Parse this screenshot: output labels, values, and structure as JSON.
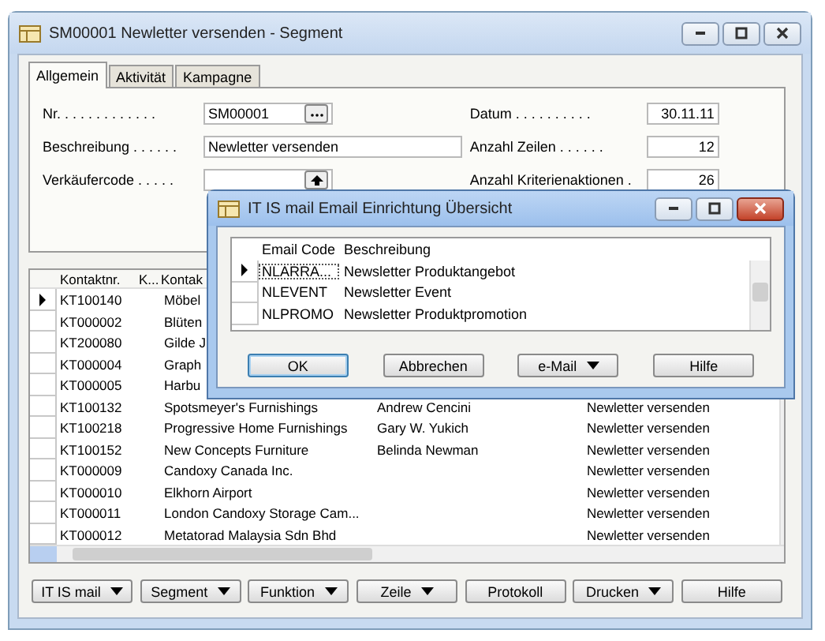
{
  "window": {
    "title": "SM00001 Newletter versenden - Segment"
  },
  "tabs": [
    {
      "label": "Allgemein",
      "selected": true
    },
    {
      "label": "Aktivität",
      "selected": false
    },
    {
      "label": "Kampagne",
      "selected": false
    }
  ],
  "fields_left": [
    {
      "label": "Nr. . . . . . . . . . . . .",
      "value": "SM00001",
      "kind": "lookup"
    },
    {
      "label": "Beschreibung . . . . . .",
      "value": "Newletter versenden",
      "kind": "text"
    },
    {
      "label": "Verkäufercode . . . . .",
      "kind": "dropdown"
    }
  ],
  "fields_right": [
    {
      "label": "Datum . . . . . . . . . .",
      "value": "30.11.11"
    },
    {
      "label": "Anzahl Zeilen . . . . . .",
      "value": "12"
    },
    {
      "label": "Anzahl Kriterienaktionen .",
      "value": "26"
    }
  ],
  "table": {
    "columns": [
      "Kontaktnr.",
      "K...",
      "Kontak"
    ],
    "rows": [
      {
        "selected": true,
        "contact_no": "KT100140",
        "name": "Möbel"
      },
      {
        "selected": false,
        "contact_no": "KT000002",
        "name": "Blüten"
      },
      {
        "selected": false,
        "contact_no": "KT200080",
        "name": "Gilde J"
      },
      {
        "selected": false,
        "contact_no": "KT000004",
        "name": "Graph"
      },
      {
        "selected": false,
        "contact_no": "KT000005",
        "name": "Harbu"
      },
      {
        "selected": false,
        "contact_no": "KT100132",
        "name": "Spotsmeyer's Furnishings",
        "column_4": "Andrew Cencini",
        "column_5": "Newletter versenden"
      },
      {
        "selected": false,
        "contact_no": "KT100218",
        "name": "Progressive Home Furnishings",
        "column_4": "Gary W. Yukich",
        "column_5": "Newletter versenden"
      },
      {
        "selected": false,
        "contact_no": "KT100152",
        "name": "New Concepts Furniture",
        "column_4": "Belinda Newman",
        "column_5": "Newletter versenden"
      },
      {
        "selected": false,
        "contact_no": "KT000009",
        "name": "Candoxy Canada Inc.",
        "column_5": "Newletter versenden"
      },
      {
        "selected": false,
        "contact_no": "KT000010",
        "name": "Elkhorn Airport",
        "column_5": "Newletter versenden"
      },
      {
        "selected": false,
        "contact_no": "KT000011",
        "name": "London Candoxy Storage Cam...",
        "column_5": "Newletter versenden"
      },
      {
        "selected": false,
        "contact_no": "KT000012",
        "name": "Metatorad Malaysia Sdn Bhd",
        "column_5": "Newletter versenden"
      }
    ]
  },
  "buttons": [
    {
      "label": "IT IS mail",
      "dropdown": true
    },
    {
      "label": "Segment",
      "dropdown": true
    },
    {
      "label": "Funktion",
      "dropdown": true
    },
    {
      "label": "Zeile",
      "dropdown": true
    },
    {
      "label": "Protokoll",
      "dropdown": false
    },
    {
      "label": "Drucken",
      "dropdown": true
    },
    {
      "label": "Hilfe",
      "dropdown": false
    }
  ],
  "dialog": {
    "title": "IT IS mail Email Einrichtung Übersicht",
    "columns": [
      "Email Code",
      "Beschreibung"
    ],
    "rows": [
      {
        "selected": true,
        "code": "NLARRA...",
        "description": "Newsletter Produktangebot"
      },
      {
        "selected": false,
        "code": "NLEVENT",
        "description": "Newsletter Event"
      },
      {
        "selected": false,
        "code": "NLPROMO",
        "description": "Newsletter Produktpromotion"
      }
    ],
    "buttons": [
      {
        "label": "OK",
        "dropdown": false,
        "default": true
      },
      {
        "label": "Abbrechen",
        "dropdown": false,
        "default": false
      },
      {
        "label": "e-Mail",
        "dropdown": true,
        "default": false
      },
      {
        "label": "Hilfe",
        "dropdown": false,
        "default": false
      }
    ]
  }
}
